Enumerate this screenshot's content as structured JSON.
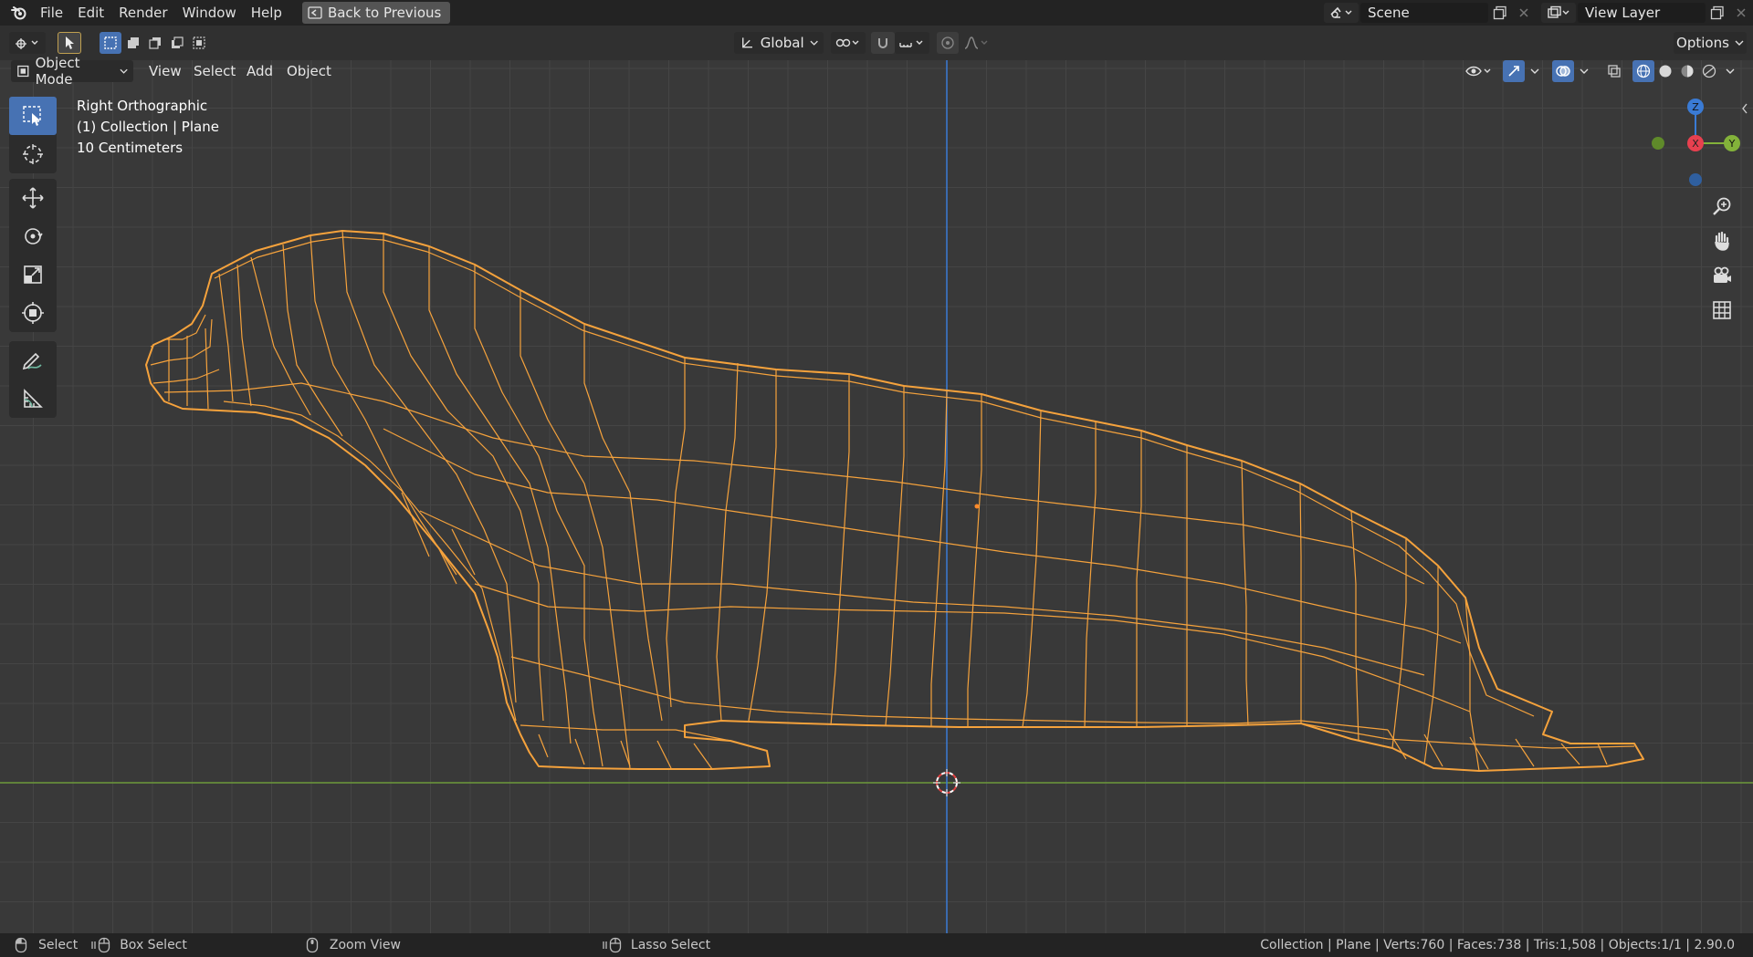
{
  "menubar": {
    "items": [
      "File",
      "Edit",
      "Render",
      "Window",
      "Help"
    ],
    "back_button": "Back to Previous",
    "scene": "Scene",
    "view_layer": "View Layer"
  },
  "toolheader": {
    "transform_orientation": "Global",
    "options_label": "Options"
  },
  "viewport_header": {
    "mode": "Object Mode",
    "menus": [
      "View",
      "Select",
      "Add",
      "Object"
    ]
  },
  "overlay": {
    "view_name": "Right Orthographic",
    "collection_info": "(1) Collection | Plane",
    "grid_scale": "10 Centimeters"
  },
  "gizmo": {
    "z": "Z",
    "x": "X",
    "y": "Y"
  },
  "statusbar": {
    "select": "Select",
    "box_select": "Box Select",
    "zoom_view": "Zoom View",
    "lasso_select": "Lasso Select",
    "stats": "Collection | Plane | Verts:760 | Faces:738 | Tris:1,508 | Objects:1/1 | 2.90.0"
  },
  "colors": {
    "wire": "#f5a23c",
    "axis_z": "#3a7bd5",
    "axis_y": "#6d9a3a",
    "accent": "#4772b3"
  }
}
